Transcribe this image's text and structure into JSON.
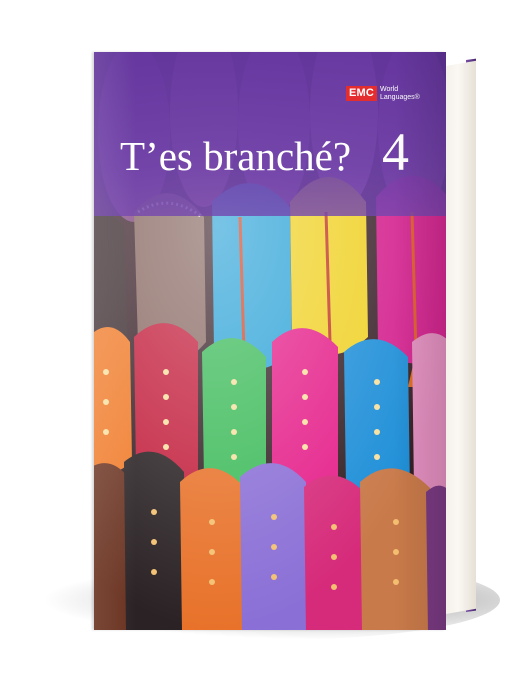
{
  "book": {
    "title": "T’es branché?",
    "volume": "4",
    "publisher": {
      "mark": "EMC",
      "name": "World Languages",
      "trademark": "®"
    }
  },
  "colors": {
    "band": "#6a3ea8",
    "logo_red": "#e42d2f",
    "text": "#ffffff"
  }
}
